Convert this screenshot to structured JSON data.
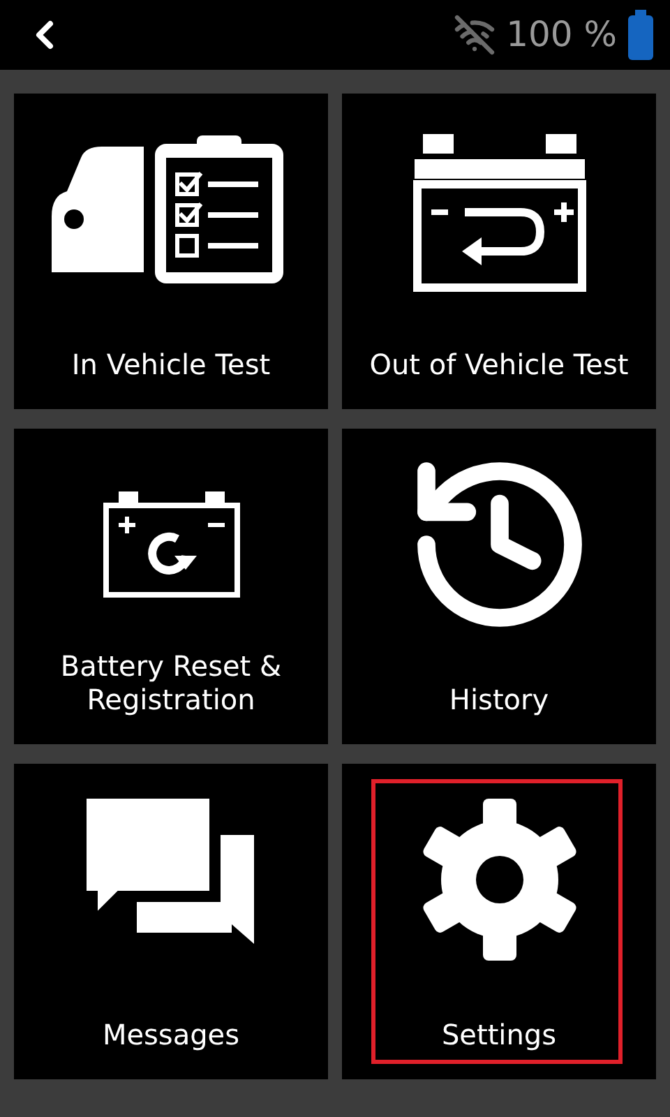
{
  "status_bar": {
    "battery_text": "100 %"
  },
  "tiles": [
    {
      "kind": "vehicle-test",
      "label": "In Vehicle Test",
      "selected": false
    },
    {
      "kind": "battery-swap",
      "label": "Out of Vehicle Test",
      "selected": false
    },
    {
      "kind": "battery-reset",
      "label": "Battery Reset & Registration",
      "selected": false
    },
    {
      "kind": "history",
      "label": "History",
      "selected": false
    },
    {
      "kind": "messages",
      "label": "Messages",
      "selected": false
    },
    {
      "kind": "settings",
      "label": "Settings",
      "selected": true
    }
  ]
}
